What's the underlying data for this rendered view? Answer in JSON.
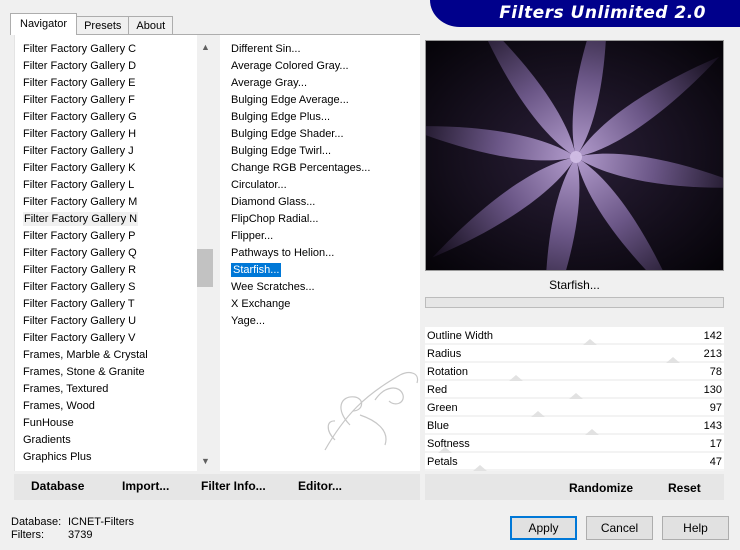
{
  "tabs": [
    {
      "label": "Navigator",
      "active": true
    },
    {
      "label": "Presets",
      "active": false
    },
    {
      "label": "About",
      "active": false
    }
  ],
  "banner": {
    "title": "Filters Unlimited 2.0"
  },
  "categories": [
    "Filter Factory Gallery C",
    "Filter Factory Gallery D",
    "Filter Factory Gallery E",
    "Filter Factory Gallery F",
    "Filter Factory Gallery G",
    "Filter Factory Gallery H",
    "Filter Factory Gallery J",
    "Filter Factory Gallery K",
    "Filter Factory Gallery L",
    "Filter Factory Gallery M",
    "Filter Factory Gallery N",
    "Filter Factory Gallery P",
    "Filter Factory Gallery Q",
    "Filter Factory Gallery R",
    "Filter Factory Gallery S",
    "Filter Factory Gallery T",
    "Filter Factory Gallery U",
    "Filter Factory Gallery V",
    "Frames, Marble & Crystal",
    "Frames, Stone & Granite",
    "Frames, Textured",
    "Frames, Wood",
    "FunHouse",
    "Gradients",
    "Graphics Plus"
  ],
  "selected_category": "Filter Factory Gallery N",
  "filters": [
    "Different Sin...",
    "Average Colored Gray...",
    "Average Gray...",
    "Bulging Edge Average...",
    "Bulging Edge Plus...",
    "Bulging Edge Shader...",
    "Bulging Edge Twirl...",
    "Change RGB Percentages...",
    "Circulator...",
    "Diamond Glass...",
    "FlipChop Radial...",
    "Flipper...",
    "Pathways to Helion...",
    "Starfish...",
    "Wee Scratches...",
    "X Exchange",
    "Yage..."
  ],
  "selected_filter": "Starfish...",
  "bottom_buttons": {
    "database": "Database",
    "import": "Import...",
    "filter_info": "Filter Info...",
    "editor": "Editor..."
  },
  "preview": {
    "filter_name": "Starfish...",
    "progress": 0
  },
  "params": [
    {
      "name": "Outline Width",
      "value": 142
    },
    {
      "name": "Radius",
      "value": 213
    },
    {
      "name": "Rotation",
      "value": 78
    },
    {
      "name": "Red",
      "value": 130
    },
    {
      "name": "Green",
      "value": 97
    },
    {
      "name": "Blue",
      "value": 143
    },
    {
      "name": "Softness",
      "value": 17
    },
    {
      "name": "Petals",
      "value": 47
    }
  ],
  "param_max": 255,
  "param_buttons": {
    "randomize": "Randomize",
    "reset": "Reset"
  },
  "db_info": {
    "database_label": "Database:",
    "database_value": "ICNET-Filters",
    "filters_label": "Filters:",
    "filters_value": "3739"
  },
  "dialog_buttons": {
    "apply": "Apply",
    "cancel": "Cancel",
    "help": "Help"
  },
  "colors": {
    "accent": "#0078d7",
    "banner": "#00008b",
    "petal": "#8a74a6"
  },
  "icons": {
    "scroll_up": "chevron-up-icon",
    "scroll_down": "chevron-down-icon"
  }
}
